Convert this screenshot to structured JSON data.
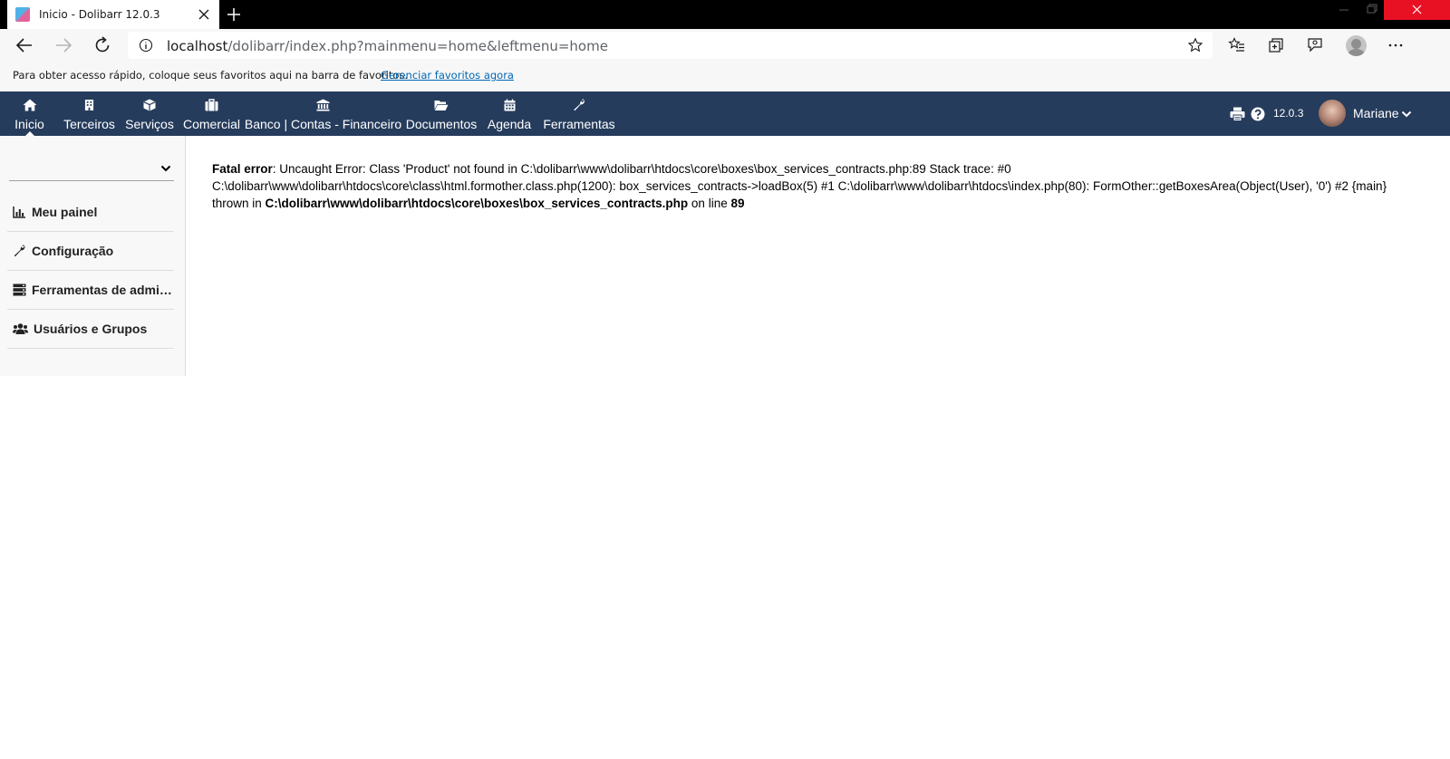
{
  "browser": {
    "tab_title": "Inicio - Dolibarr 12.0.3",
    "url_host": "localhost",
    "url_path": "/dolibarr/index.php?mainmenu=home&leftmenu=home",
    "favorites_bar_text": "Para obter acesso rápido, coloque seus favoritos aqui na barra de favoritos.",
    "favorites_bar_link": "Gerenciar favoritos agora"
  },
  "topmenu": {
    "items": [
      {
        "label": "Inicio",
        "icon": "home-icon",
        "active": true
      },
      {
        "label": "Terceiros",
        "icon": "building-icon"
      },
      {
        "label": "Serviços",
        "icon": "cube-icon"
      },
      {
        "label": "Comercial",
        "icon": "briefcase-icon"
      },
      {
        "label": "Banco | Contas - Financeiro",
        "icon": "bank-icon"
      },
      {
        "label": "Documentos",
        "icon": "folder-open-icon"
      },
      {
        "label": "Agenda",
        "icon": "calendar-icon"
      },
      {
        "label": "Ferramentas",
        "icon": "wrench-icon"
      }
    ],
    "version": "12.0.3",
    "user_name": "Mariane"
  },
  "leftmenu": {
    "items": [
      {
        "label": "Meu painel",
        "icon": "chart-icon"
      },
      {
        "label": "Configuração",
        "icon": "wrench-icon"
      },
      {
        "label": "Ferramentas de administração",
        "icon": "server-icon"
      },
      {
        "label": "Usuários e Grupos",
        "icon": "users-icon"
      }
    ]
  },
  "error": {
    "title": "Fatal error",
    "message": ": Uncaught Error: Class 'Product' not found in C:\\dolibarr\\www\\dolibarr\\htdocs\\core\\boxes\\box_services_contracts.php:89 Stack trace: #0 C:\\dolibarr\\www\\dolibarr\\htdocs\\core\\class\\html.formother.class.php(1200): box_services_contracts->loadBox(5) #1 C:\\dolibarr\\www\\dolibarr\\htdocs\\index.php(80): FormOther::getBoxesArea(Object(User), '0') #2 {main} thrown in ",
    "file": "C:\\dolibarr\\www\\dolibarr\\htdocs\\core\\boxes\\box_services_contracts.php",
    "on_line_text": " on line ",
    "line": "89"
  },
  "colors": {
    "topmenu_bg": "#263c5c",
    "browser_chrome": "#f7f7f7",
    "link": "#0066b4"
  }
}
